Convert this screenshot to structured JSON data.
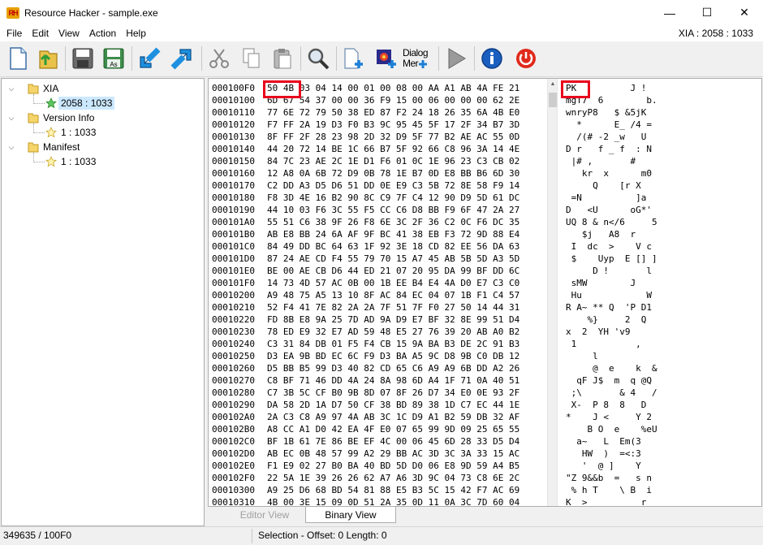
{
  "window": {
    "title": "Resource Hacker - sample.exe",
    "icon_text": "RH",
    "minimize_glyph": "—",
    "maximize_glyph": "☐",
    "close_glyph": "✕"
  },
  "menu": {
    "items": [
      "File",
      "Edit",
      "View",
      "Action",
      "Help"
    ],
    "right_info": "XIA : 2058 : 1033"
  },
  "toolbar": {
    "buttons": [
      {
        "name": "new-file-icon"
      },
      {
        "name": "open-file-icon"
      },
      {
        "name": "save-icon"
      },
      {
        "name": "save-as-icon"
      },
      {
        "name": "back-arrow-icon"
      },
      {
        "name": "forward-arrow-icon"
      },
      {
        "name": "cut-icon"
      },
      {
        "name": "copy-icon"
      },
      {
        "name": "paste-icon"
      },
      {
        "name": "search-icon"
      },
      {
        "name": "add-resource-icon"
      },
      {
        "name": "add-image-resource-icon"
      },
      {
        "name": "dialog-merger-icon"
      },
      {
        "name": "run-icon"
      },
      {
        "name": "info-icon"
      },
      {
        "name": "power-icon"
      }
    ],
    "dialog_text_1": "Dialog",
    "dialog_text_2": "Mer"
  },
  "tree": {
    "nodes": [
      {
        "label": "XIA",
        "level": 0,
        "type": "folder",
        "expanded": true
      },
      {
        "label": "2058 : 1033",
        "level": 1,
        "type": "star-green",
        "selected": true
      },
      {
        "label": "Version Info",
        "level": 0,
        "type": "folder",
        "expanded": true
      },
      {
        "label": "1 : 1033",
        "level": 1,
        "type": "star"
      },
      {
        "label": "Manifest",
        "level": 0,
        "type": "folder",
        "expanded": true
      },
      {
        "label": "1 : 1033",
        "level": 1,
        "type": "star"
      }
    ]
  },
  "hex": {
    "rows": [
      {
        "offset": "000100F0",
        "bytes": "50 4B 03 04 14 00 01 00 08 00 AA A1 AB 4A FE 21",
        "ascii": "PK          J !"
      },
      {
        "offset": "00010100",
        "bytes": "6D 67 54 37 00 00 36 F9 15 00 06 00 00 00 62 2E",
        "ascii": "mgT7  6        b."
      },
      {
        "offset": "00010110",
        "bytes": "77 6E 72 79 50 38 ED 87 F2 24 18 26 35 6A 4B E0",
        "ascii": "wnryP8   $ &5jK"
      },
      {
        "offset": "00010120",
        "bytes": "F7 FF 2A 19 D3 F0 B3 9C 95 45 5F 17 2F 34 B7 3D",
        "ascii": "  *      E_ /4 ="
      },
      {
        "offset": "00010130",
        "bytes": "8F FF 2F 28 23 98 2D 32 D9 5F 77 B2 AE AC 55 0D",
        "ascii": "  /(# -2 _w   U"
      },
      {
        "offset": "00010140",
        "bytes": "44 20 72 14 BE 1C 66 B7 5F 92 66 C8 96 3A 14 4E",
        "ascii": "D r   f _ f  : N"
      },
      {
        "offset": "00010150",
        "bytes": "84 7C 23 AE 2C 1E D1 F6 01 0C 1E 96 23 C3 CB 02",
        "ascii": " |# ,       #"
      },
      {
        "offset": "00010160",
        "bytes": "12 A8 0A 6B 72 D9 0B 78 1E B7 0D E8 BB B6 6D 30",
        "ascii": "   kr  x      m0"
      },
      {
        "offset": "00010170",
        "bytes": "C2 DD A3 D5 D6 51 DD 0E E9 C3 5B 72 8E 58 F9 14",
        "ascii": "     Q    [r X"
      },
      {
        "offset": "00010180",
        "bytes": "F8 3D 4E 16 B2 90 8C C9 7F C4 12 90 D9 5D 61 DC",
        "ascii": " =N          ]a"
      },
      {
        "offset": "00010190",
        "bytes": "44 10 03 F6 3C 55 F5 CC C6 D8 BB F9 6F 47 2A 27",
        "ascii": "D   <U      oG*'"
      },
      {
        "offset": "000101A0",
        "bytes": "55 51 C6 38 9F 26 F8 6E 3C 2F 36 C2 0C F6 DC 35",
        "ascii": "UQ 8 & n</6     5"
      },
      {
        "offset": "000101B0",
        "bytes": "AB E8 BB 24 6A AF 9F BC 41 38 EB F3 72 9D 88 E4",
        "ascii": "   $j   A8  r"
      },
      {
        "offset": "000101C0",
        "bytes": "84 49 DD BC 64 63 1F 92 3E 18 CD 82 EE 56 DA 63",
        "ascii": " I  dc  >    V c"
      },
      {
        "offset": "000101D0",
        "bytes": "87 24 AE CD F4 55 79 70 15 A7 45 AB 5B 5D A3 5D",
        "ascii": " $    Uyp  E [] ]"
      },
      {
        "offset": "000101E0",
        "bytes": "BE 00 AE CB D6 44 ED 21 07 20 95 DA 99 BF DD 6C",
        "ascii": "     D !       l"
      },
      {
        "offset": "000101F0",
        "bytes": "14 73 4D 57 AC 0B 00 1B EE B4 E4 4A D0 E7 C3 C0",
        "ascii": " sMW        J"
      },
      {
        "offset": "00010200",
        "bytes": "A9 48 75 A5 13 10 8F AC 84 EC 04 07 1B F1 C4 57",
        "ascii": " Hu            W"
      },
      {
        "offset": "00010210",
        "bytes": "52 F4 41 7E 82 2A 2A 7F 51 7F F0 27 50 14 44 31",
        "ascii": "R A~ ** Q  'P D1"
      },
      {
        "offset": "00010220",
        "bytes": "FD 8B E8 9A 25 7D AD 9A D9 E7 BF 32 8E 99 51 D4",
        "ascii": "    %}     2  Q"
      },
      {
        "offset": "00010230",
        "bytes": "78 ED E9 32 E7 AD 59 48 E5 27 76 39 20 AB A0 B2",
        "ascii": "x  2  YH 'v9"
      },
      {
        "offset": "00010240",
        "bytes": "C3 31 84 DB 01 F5 F4 CB 15 9A BA B3 DE 2C 91 B3",
        "ascii": " 1           ,"
      },
      {
        "offset": "00010250",
        "bytes": "D3 EA 9B BD EC 6C F9 D3 BA A5 9C D8 9B C0 DB 12",
        "ascii": "     l"
      },
      {
        "offset": "00010260",
        "bytes": "D5 BB B5 99 D3 40 82 CD 65 C6 A9 A9 6B DD A2 26",
        "ascii": "     @  e    k  &"
      },
      {
        "offset": "00010270",
        "bytes": "C8 BF 71 46 DD 4A 24 8A 98 6D A4 1F 71 0A 40 51",
        "ascii": "  qF J$  m  q @Q"
      },
      {
        "offset": "00010280",
        "bytes": "C7 3B 5C CF B0 9B 8D 07 8F 26 D7 34 E0 0E 93 2F",
        "ascii": " ;\\       & 4   /"
      },
      {
        "offset": "00010290",
        "bytes": "DA 58 2D 1A D7 50 CF 38 BD 89 38 1D C7 EC 44 1E",
        "ascii": " X-  P 8  8   D"
      },
      {
        "offset": "000102A0",
        "bytes": "2A C3 C8 A9 97 4A AB 3C 1C D9 A1 B2 59 DB 32 AF",
        "ascii": "*    J <     Y 2"
      },
      {
        "offset": "000102B0",
        "bytes": "A8 CC A1 D0 42 EA 4F E0 07 65 99 9D 09 25 65 55",
        "ascii": "    B O  e    %eU"
      },
      {
        "offset": "000102C0",
        "bytes": "BF 1B 61 7E 86 BE EF 4C 00 06 45 6D 28 33 D5 D4",
        "ascii": "  a~   L  Em(3"
      },
      {
        "offset": "000102D0",
        "bytes": "AB EC 0B 48 57 99 A2 29 BB AC 3D 3C 3A 33 15 AC",
        "ascii": "   HW  )  =<:3"
      },
      {
        "offset": "000102E0",
        "bytes": "F1 E9 02 27 B0 BA 40 BD 5D D0 06 E8 9D 59 A4 B5",
        "ascii": "   '  @ ]    Y"
      },
      {
        "offset": "000102F0",
        "bytes": "22 5A 1E 39 26 26 62 A7 A6 3D 9C 04 73 C8 6E 2C",
        "ascii": "\"Z 9&&b  =   s n"
      },
      {
        "offset": "00010300",
        "bytes": "A9 25 D6 68 BD 54 81 88 E5 B3 5C 15 42 F7 AC 69",
        "ascii": " % h T    \\ B  i"
      },
      {
        "offset": "00010310",
        "bytes": "4B 00 3E 15 09 0D 51 2A 35 0D 11 0A 3C 7D 60 04",
        "ascii": "K  >          r"
      }
    ]
  },
  "tabs": {
    "editor_view": "Editor View",
    "binary_view": "Binary View"
  },
  "status": {
    "left": "349635 / 100F0",
    "middle": "Selection - Offset: 0  Length: 0"
  },
  "colors": {
    "highlight": "#e8001c",
    "selection_bg": "#cce8ff"
  }
}
